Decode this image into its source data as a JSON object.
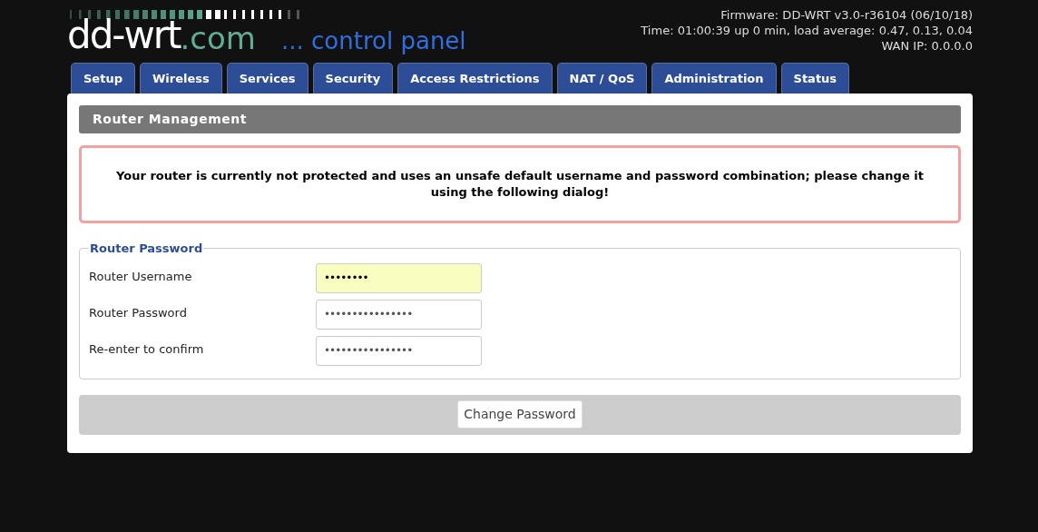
{
  "header": {
    "logo": "dd-wrt",
    "logo_suffix": ".com",
    "tagline": "... control panel",
    "info": [
      "Firmware: DD-WRT v3.0-r36104 (06/10/18)",
      "Time: 01:00:39 up 0 min, load average: 0.47, 0.13, 0.04",
      "WAN IP: 0.0.0.0"
    ]
  },
  "tabs": [
    {
      "label": "Setup"
    },
    {
      "label": "Wireless"
    },
    {
      "label": "Services"
    },
    {
      "label": "Security"
    },
    {
      "label": "Access Restrictions"
    },
    {
      "label": "NAT / QoS"
    },
    {
      "label": "Administration"
    },
    {
      "label": "Status"
    }
  ],
  "section_title": "Router Management",
  "warning": "Your router is currently not protected and uses an unsafe default username and password combination; please change it using the following dialog!",
  "fieldset": {
    "legend": "Router Password",
    "fields": [
      {
        "label": "Router Username",
        "value": "••••••••",
        "highlighted": true
      },
      {
        "label": "Router Password",
        "value": "••••••••••••••••",
        "highlighted": false
      },
      {
        "label": "Re-enter to confirm",
        "value": "••••••••••••••••",
        "highlighted": false
      }
    ]
  },
  "button": "Change Password"
}
